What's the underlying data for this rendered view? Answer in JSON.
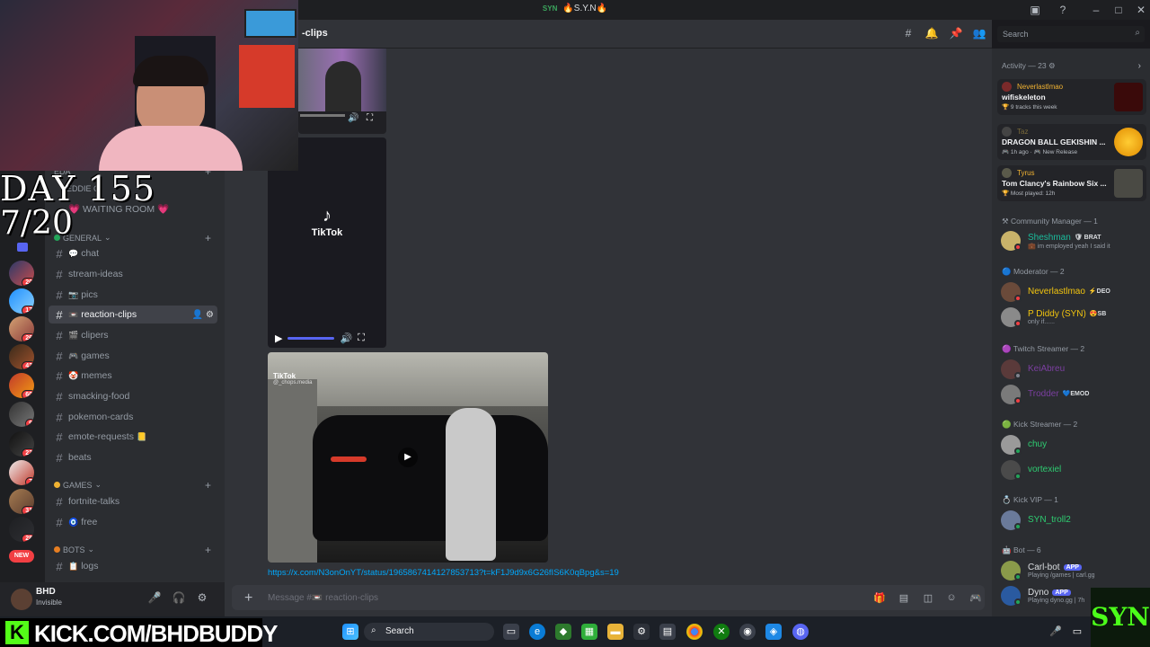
{
  "window": {
    "title": "S.Y.N",
    "server_tag": "SYN",
    "title_prefix": "🔥",
    "title_suffix": "🔥"
  },
  "header": {
    "channel_name": "-clips"
  },
  "search": {
    "placeholder": "Search"
  },
  "servers": [
    {
      "badge": "20"
    },
    {
      "badge": "17"
    },
    {
      "badge": "26"
    },
    {
      "badge": "42"
    },
    {
      "badge": "60"
    },
    {
      "badge": "9"
    },
    {
      "badge": "22"
    },
    {
      "badge": "7"
    },
    {
      "badge": "31"
    },
    {
      "badge": "28"
    }
  ],
  "new_badge": "NEW",
  "sidebar": {
    "partial_category": "EDA",
    "partial_category_item": "EDDIE C",
    "waiting_room": "💗 WAITING ROOM 💗",
    "cat_general": "GENERAL",
    "cat_games": "GAMES",
    "cat_bots": "BOTS",
    "channels": [
      {
        "icon": "💬",
        "name": "chat"
      },
      {
        "icon": "",
        "name": "stream-ideas"
      },
      {
        "icon": "📷",
        "name": "pics"
      },
      {
        "icon": "📼",
        "name": "reaction-clips"
      },
      {
        "icon": "🎬",
        "name": "clipers"
      },
      {
        "icon": "🎮",
        "name": "games"
      },
      {
        "icon": "🤡",
        "name": "memes"
      },
      {
        "icon": "",
        "name": "smacking-food"
      },
      {
        "icon": "",
        "name": "pokemon-cards"
      },
      {
        "icon": "",
        "name": "emote-requests",
        "suffix": "📒"
      },
      {
        "icon": "",
        "name": "beats"
      },
      {
        "icon": "",
        "name": "fortnite-talks"
      },
      {
        "icon": "🧿",
        "name": "free"
      },
      {
        "icon": "📋",
        "name": "logs"
      }
    ]
  },
  "user": {
    "name": "BHD",
    "status": "Invisible"
  },
  "messages": {
    "tiktok_brand": "TikTok",
    "video_watermark": "TikTok",
    "video_handle": "@_chops.media",
    "link": "https://x.com/N3onOnYT/status/1965867414127853713?t=kF1J9d9x6G26fIS6K0qBpg&s=19"
  },
  "composer": {
    "placeholder": "Message #📼 reaction-clips"
  },
  "members": {
    "activity_title": "Activity — 23",
    "activities": [
      {
        "user": "Neverlastlmao",
        "title": "wifiskeleton",
        "sub": "🏆 9 tracks this week",
        "color": "#8b1a1a"
      },
      {
        "user": "Taz",
        "title": "DRAGON BALL GEKISHIN ...",
        "sub": "🎮 1h ago · 🎮 New Release",
        "color": "#f5a623"
      },
      {
        "user": "Tyrus",
        "title": "Tom Clancy's Rainbow Six ...",
        "sub": "🏆 Most played: 12h",
        "color": "#555555"
      }
    ],
    "roles": [
      {
        "title": "⚒ Community Manager — 1",
        "members": [
          {
            "name": "Sheshman",
            "tag": "🛡 BRAT",
            "sub": "💼 im employed yeah I said it",
            "color": "#1abc9c"
          }
        ]
      },
      {
        "title": "🔵 Moderator — 2",
        "members": [
          {
            "name": "Neverlastlmao",
            "tag": "⚡DEO",
            "sub": "",
            "color": "#f1c40f"
          },
          {
            "name": "P Diddy (SYN)",
            "tag": "😍SB",
            "sub": "only if......",
            "color": "#f1c40f"
          }
        ]
      },
      {
        "title": "🟣 Twitch Streamer — 2",
        "members": [
          {
            "name": "KeiAbreu",
            "tag": "",
            "sub": "",
            "color": "#7b3fa0"
          },
          {
            "name": "Trodder",
            "tag": "💙EMOD",
            "sub": "",
            "color": "#7b3fa0"
          }
        ]
      },
      {
        "title": "🟢 Kick Streamer — 2",
        "members": [
          {
            "name": "chuy",
            "tag": "",
            "sub": "",
            "color": "#2ecc71"
          },
          {
            "name": "vortexiel",
            "tag": "",
            "sub": "",
            "color": "#2ecc71"
          }
        ]
      },
      {
        "title": "💍 Kick VIP — 1",
        "members": [
          {
            "name": "SYN_troll2",
            "tag": "",
            "sub": "",
            "color": "#2ecc71"
          }
        ]
      },
      {
        "title": "🤖 Bot — 6",
        "members": [
          {
            "name": "Carl-bot",
            "tag": "APP",
            "sub": "Playing /games | carl.gg",
            "color": "#dbdee1"
          },
          {
            "name": "Dyno",
            "tag": "APP",
            "sub": "Playing dyno.gg | 7h",
            "color": "#dbdee1"
          }
        ]
      }
    ]
  },
  "taskbar": {
    "search_label": "Search"
  },
  "overlay": {
    "day_text": "DAY 155",
    "day_number": "7/20",
    "kick_url": "KICK.COM/BHDBUDDY",
    "kick_k": "K",
    "syn_logo": "SYN"
  },
  "colors": {
    "accent": "#5865f2",
    "link": "#00a8fc",
    "kick_green": "#53fc18"
  }
}
